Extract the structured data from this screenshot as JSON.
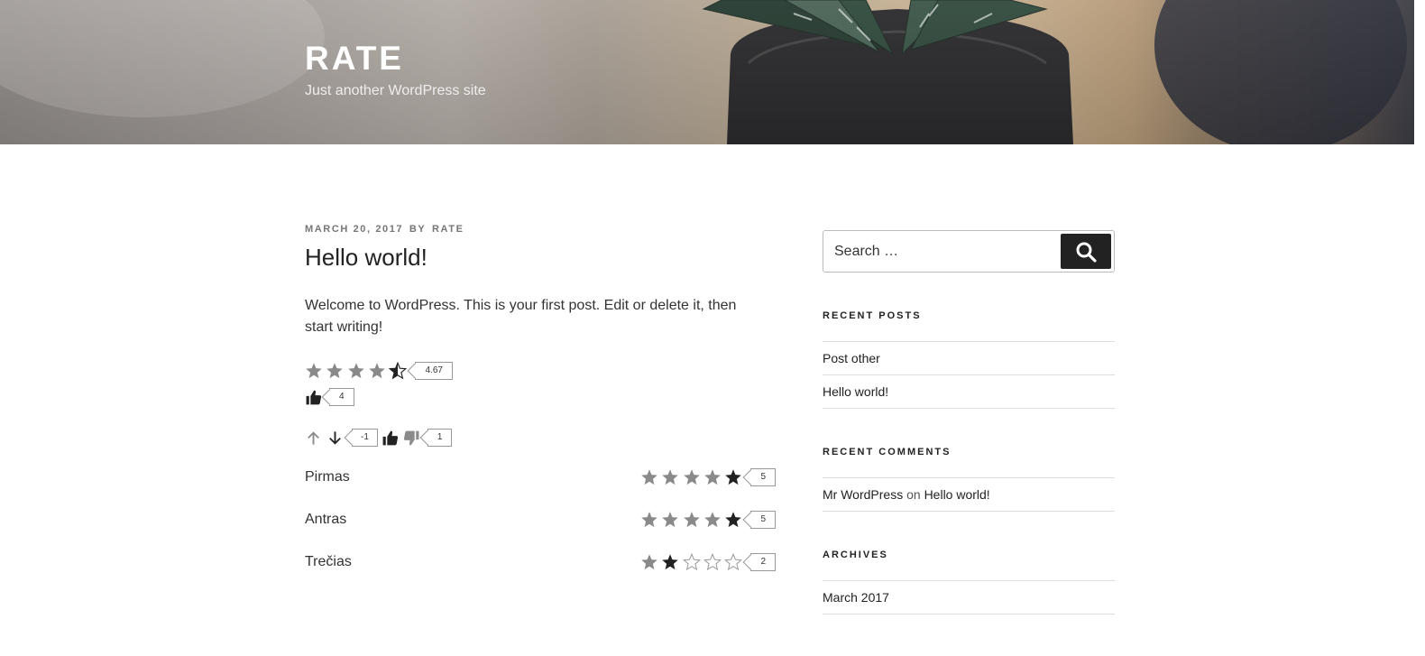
{
  "site": {
    "title": "RATE",
    "description": "Just another WordPress site"
  },
  "post": {
    "date": "MARCH 20, 2017",
    "by": "BY",
    "author": "RATE",
    "title": "Hello world!",
    "body": "Welcome to WordPress. This is your first post. Edit or delete it, then start writing!",
    "star_rating": {
      "value": 4.67,
      "label": "4.67",
      "max": 5
    },
    "likes": {
      "count_label": "4"
    },
    "updown": {
      "score_label": "-1"
    },
    "thumbs": {
      "count_label": "1"
    },
    "criteria": [
      {
        "label": "Pirmas",
        "rating": 5,
        "count_label": "5"
      },
      {
        "label": "Antras",
        "rating": 5,
        "count_label": "5"
      },
      {
        "label": "Trečias",
        "rating": 2,
        "count_label": "2"
      }
    ]
  },
  "sidebar": {
    "search": {
      "placeholder": "Search …"
    },
    "recent_posts": {
      "title": "RECENT POSTS",
      "items": [
        "Post other",
        "Hello world!"
      ]
    },
    "recent_comments": {
      "title": "RECENT COMMENTS",
      "items": [
        {
          "author": "Mr WordPress",
          "on": "on",
          "post": "Hello world!"
        }
      ]
    },
    "archives": {
      "title": "ARCHIVES",
      "items": [
        "March 2017"
      ]
    }
  },
  "colors": {
    "star_filled": "#8a8a8a",
    "star_active": "#222222",
    "star_outline": "#999999",
    "accent_dark": "#222222"
  },
  "icons": [
    "star-icon",
    "thumbs-up-icon",
    "thumbs-down-icon",
    "arrow-up-icon",
    "arrow-down-icon",
    "search-icon"
  ]
}
